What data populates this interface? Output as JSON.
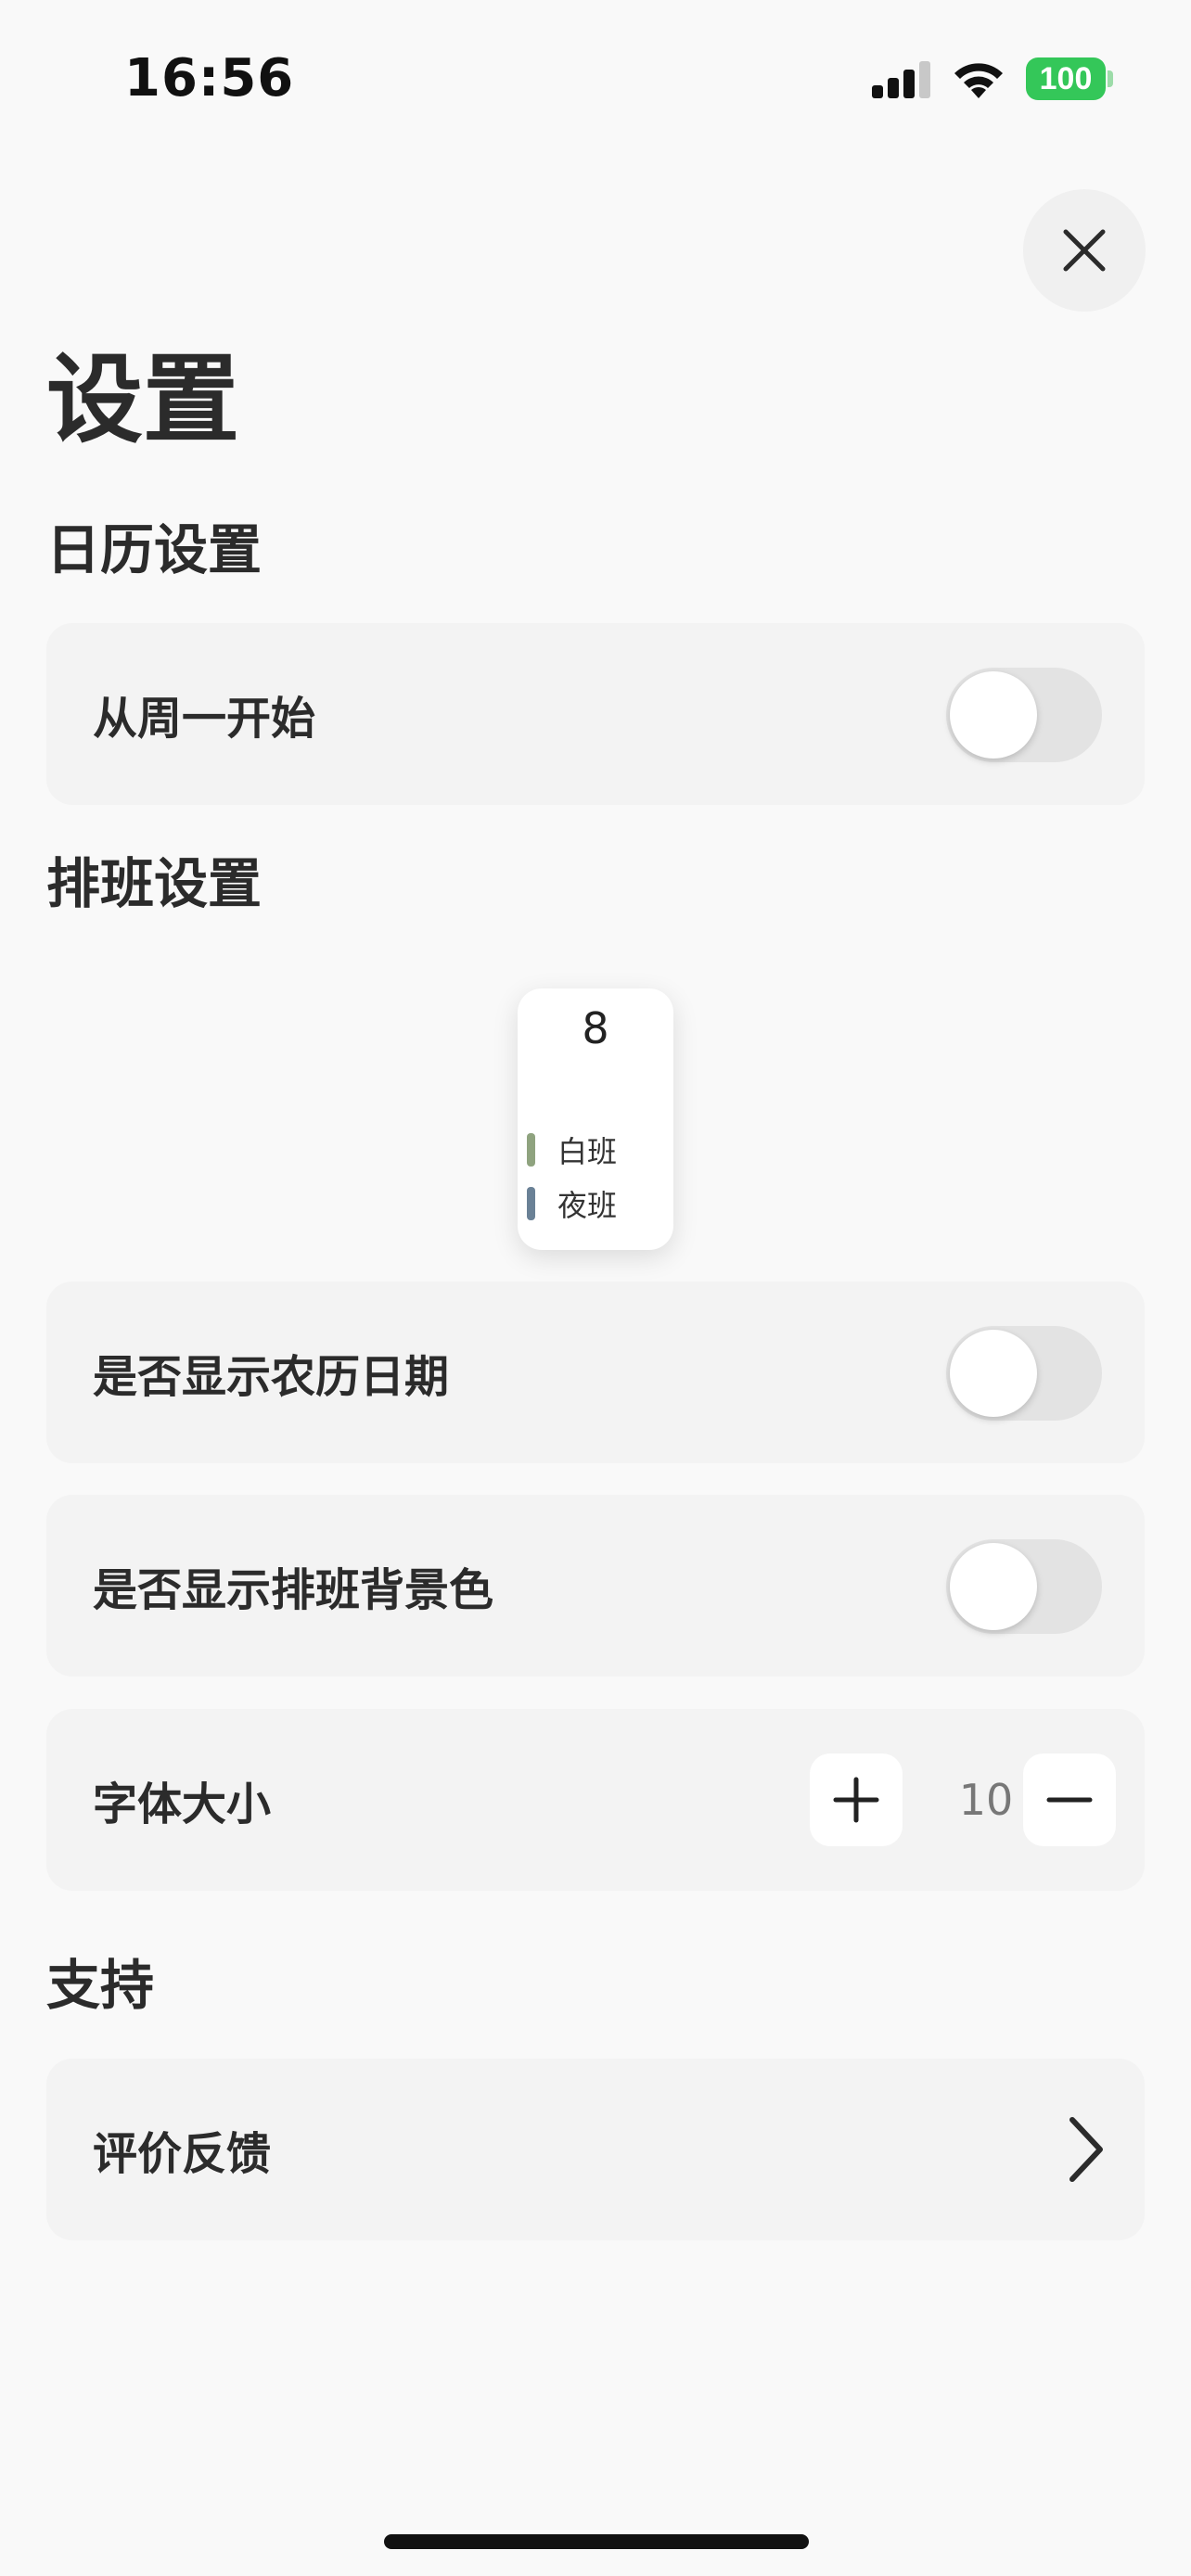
{
  "status_bar": {
    "time": "16:56",
    "battery": "100",
    "battery_color": "#34c759"
  },
  "header": {
    "title": "设置",
    "close_icon": "close-icon"
  },
  "sections": {
    "calendar": {
      "title": "日历设置",
      "week_start_label": "从周一开始",
      "week_start_on": false
    },
    "shift": {
      "title": "排班设置",
      "preview": {
        "day": "8",
        "shifts": [
          {
            "label": "白班",
            "color": "#8fa37f"
          },
          {
            "label": "夜班",
            "color": "#6a8196"
          }
        ]
      },
      "lunar_label": "是否显示农历日期",
      "lunar_on": false,
      "bg_color_label": "是否显示排班背景色",
      "bg_color_on": false,
      "font_size_label": "字体大小",
      "font_size_value": "10"
    },
    "support": {
      "title": "支持",
      "feedback_label": "评价反馈"
    }
  }
}
